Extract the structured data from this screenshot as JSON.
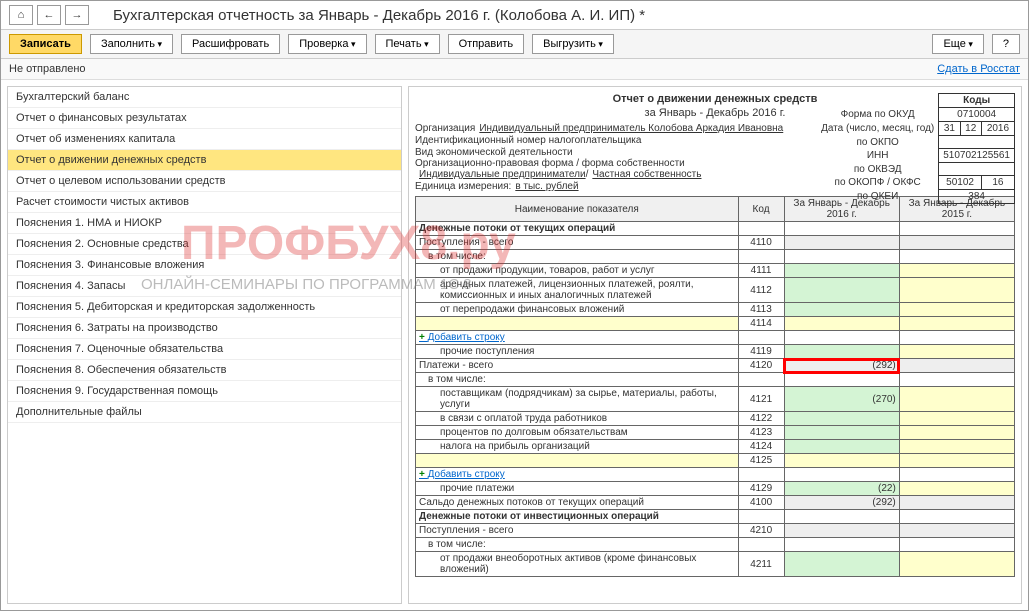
{
  "title": "Бухгалтерская отчетность за Январь - Декабрь 2016 г. (Колобова А. И. ИП) *",
  "toolbar": {
    "write": "Записать",
    "fill": "Заполнить",
    "decrypt": "Расшифровать",
    "check": "Проверка",
    "print": "Печать",
    "send": "Отправить",
    "upload": "Выгрузить",
    "more": "Еще"
  },
  "status": {
    "text": "Не отправлено",
    "link": "Сдать в Росстат"
  },
  "sidebar": [
    "Бухгалтерский баланс",
    "Отчет о финансовых результатах",
    "Отчет об изменениях капитала",
    "Отчет о движении денежных средств",
    "Отчет о целевом использовании средств",
    "Расчет стоимости чистых активов",
    "Пояснения 1. НМА и НИОКР",
    "Пояснения 2. Основные средства",
    "Пояснения 3. Финансовые вложения",
    "Пояснения 4. Запасы",
    "Пояснения 5. Дебиторская и кредиторская задолженность",
    "Пояснения 6. Затраты на производство",
    "Пояснения 7. Оценочные обязательства",
    "Пояснения 8. Обеспечения обязательств",
    "Пояснения 9. Государственная помощь",
    "Дополнительные файлы"
  ],
  "active_index": 3,
  "report": {
    "title": "Отчет о движении денежных средств",
    "period": "за Январь - Декабрь 2016 г.",
    "org_label": "Организация",
    "org": "Индивидуальный предприниматель Колобова Аркадия Ивановна",
    "inn_label": "Идентификационный номер налогоплательщика",
    "activity_label": "Вид экономической деятельности",
    "form_label": "Организационно-правовая форма / форма собственности",
    "form1": "Индивидуальные предприниматели",
    "form2": "Частная собственность",
    "unit_label": "Единица измерения:",
    "unit": "в тыс. рублей"
  },
  "codes": {
    "header": "Коды",
    "okud_label": "Форма по ОКУД",
    "okud": "0710004",
    "date_label": "Дата (число, месяц, год)",
    "d": "31",
    "m": "12",
    "y": "2016",
    "okpo_label": "по ОКПО",
    "inn_label": "ИНН",
    "inn": "510702125561",
    "okved_label": "по ОКВЭД",
    "okopf_label": "по ОКОПФ / ОКФС",
    "okopf1": "50102",
    "okopf2": "16",
    "okei_label": "по ОКЕИ",
    "okei": "384"
  },
  "table": {
    "h_name": "Наименование показателя",
    "h_code": "Код",
    "h_y1": "За Январь - Декабрь 2016 г.",
    "h_y2": "За Январь - Декабрь 2015 г.",
    "add_row": "Добавить строку"
  },
  "rows": {
    "s1": "Денежные потоки от текущих операций",
    "r4110": "Поступления - всего",
    "c4110": "4110",
    "r_incl": "в том числе:",
    "r4111": "от продажи продукции, товаров, работ и услуг",
    "c4111": "4111",
    "r4112": "арендных платежей, лицензионных платежей, роялти, комиссионных и иных аналогичных платежей",
    "c4112": "4112",
    "r4113": "от перепродажи финансовых вложений",
    "c4113": "4113",
    "c4114": "4114",
    "r4119": "прочие поступления",
    "c4119": "4119",
    "r4120": "Платежи - всего",
    "c4120": "4120",
    "v4120": "(292)",
    "r4121": "поставщикам (подрядчикам) за сырье, материалы, работы, услуги",
    "c4121": "4121",
    "v4121": "(270)",
    "r4122": "в связи с оплатой труда работников",
    "c4122": "4122",
    "r4123": "процентов по долговым обязательствам",
    "c4123": "4123",
    "r4124": "налога на прибыль организаций",
    "c4124": "4124",
    "c4125": "4125",
    "r4129": "прочие платежи",
    "c4129": "4129",
    "v4129": "(22)",
    "r4100": "Сальдо денежных потоков от текущих операций",
    "c4100": "4100",
    "v4100": "(292)",
    "s2": "Денежные потоки от инвестиционных операций",
    "r4210": "Поступления - всего",
    "c4210": "4210",
    "r4211": "от продажи внеоборотных активов (кроме финансовых вложений)",
    "c4211": "4211"
  },
  "watermark": {
    "main": "ПРОФБУХ8.ру",
    "sub": "ОНЛАЙН-СЕМИНАРЫ ПО ПРОГРАММАМ 1С 8"
  }
}
